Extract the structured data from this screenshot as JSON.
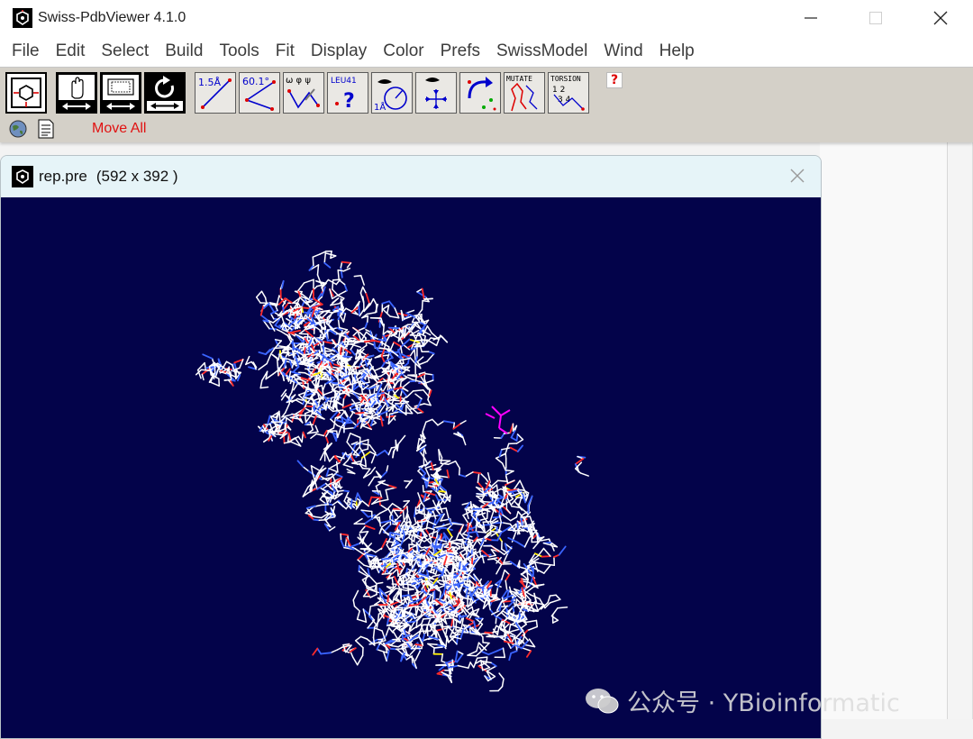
{
  "app": {
    "title": "Swiss-PdbViewer 4.1.0"
  },
  "menu": [
    "File",
    "Edit",
    "Select",
    "Build",
    "Tools",
    "Fit",
    "Display",
    "Color",
    "Prefs",
    "SwissModel",
    "Wind",
    "Help"
  ],
  "toolbar": {
    "tools": [
      {
        "name": "center-molecule",
        "icon": "center-molecule-icon"
      },
      {
        "name": "translate",
        "icon": "hand-move-icon"
      },
      {
        "name": "zoom",
        "icon": "zoom-screen-icon"
      },
      {
        "name": "rotate",
        "icon": "rotate-icon"
      },
      {
        "name": "distance",
        "icon": "distance-icon",
        "text": "1.5Å"
      },
      {
        "name": "angle",
        "icon": "angle-icon",
        "text": "60.1°"
      },
      {
        "name": "torsion-angle",
        "icon": "dihedral-icon",
        "text": "ω φ ψ"
      },
      {
        "name": "identify-residue",
        "icon": "identify-icon",
        "text": "LEU41"
      },
      {
        "name": "show-within-radius",
        "icon": "radius-icon",
        "text": "1Å"
      },
      {
        "name": "center-atom",
        "icon": "center-atom-icon"
      },
      {
        "name": "fix-fragment",
        "icon": "fix-icon"
      },
      {
        "name": "mutate",
        "icon": "mutate-icon",
        "text": "MUTATE"
      },
      {
        "name": "torsion",
        "icon": "torsion-icon",
        "text": "TORSION"
      }
    ],
    "help_label": "?",
    "mode_label": "Move All"
  },
  "molecule_window": {
    "title": "rep.pre",
    "dimensions": "(592 x 392 )",
    "background": "#03034a"
  },
  "colors": {
    "bond_carbon": "#ffffff",
    "bond_nitrogen": "#3a64ff",
    "bond_oxygen": "#ff2a2a",
    "bond_sulfur": "#ffee00",
    "ligand": "#ff00ff",
    "mode_label": "#e11111"
  },
  "watermark": {
    "text": "公众号 · YBioinformatic"
  }
}
